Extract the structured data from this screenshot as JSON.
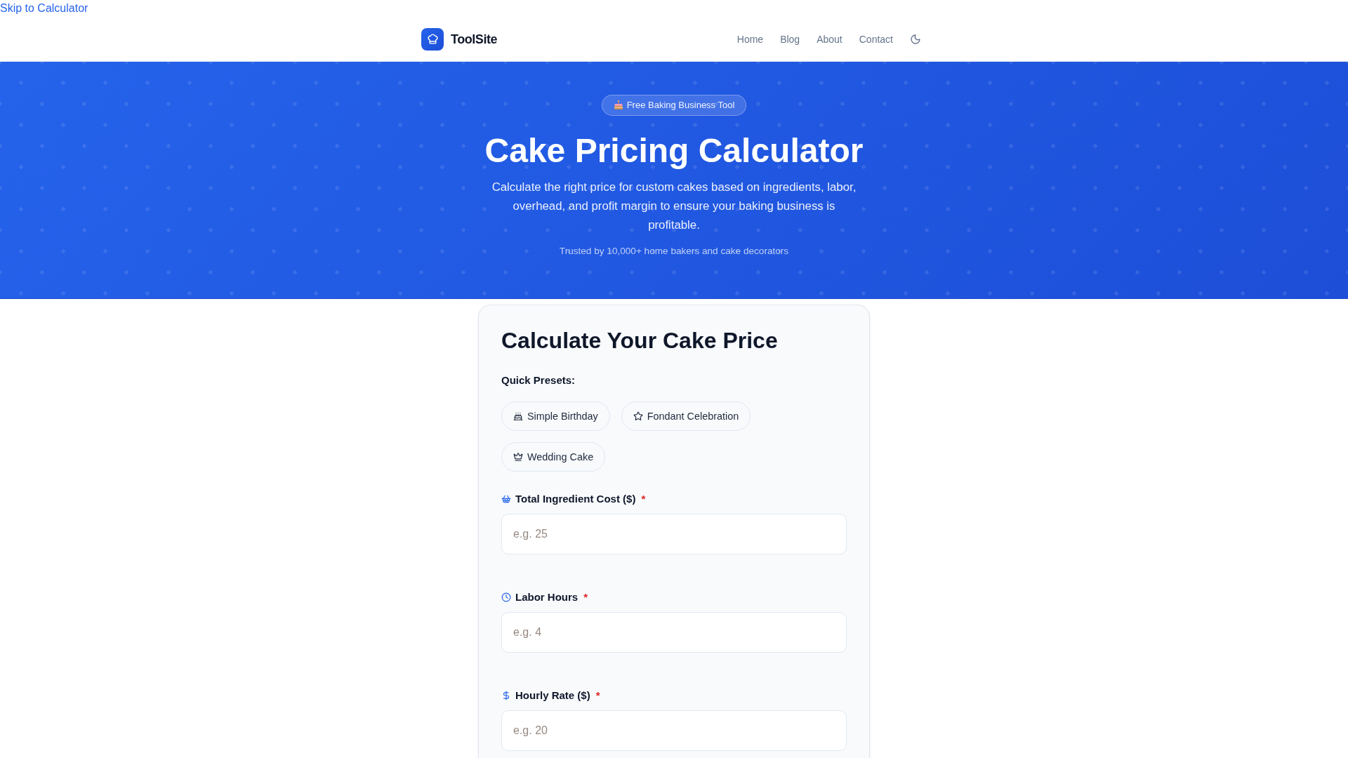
{
  "skip_link": {
    "label": "Skip to Calculator"
  },
  "header": {
    "logo": "ToolSite",
    "nav": [
      {
        "label": "Home"
      },
      {
        "label": "Blog"
      },
      {
        "label": "About"
      },
      {
        "label": "Contact"
      }
    ]
  },
  "hero": {
    "badge": "Free Baking Business Tool",
    "title": "Cake Pricing Calculator",
    "subtitle": "Calculate the right price for custom cakes based on ingredients, labor, overhead, and profit margin to ensure your baking business is profitable.",
    "trust_line": "Trusted by 10,000+ home bakers and cake decorators"
  },
  "calculator": {
    "title": "Calculate Your Cake Price",
    "presets_label": "Quick Presets:",
    "presets": [
      {
        "label": "Simple Birthday"
      },
      {
        "label": "Fondant Celebration"
      },
      {
        "label": "Wedding Cake"
      }
    ],
    "fields": [
      {
        "label": "Total Ingredient Cost ($)",
        "required_mark": "*",
        "placeholder": "e.g. 25"
      },
      {
        "label": "Labor Hours",
        "required_mark": "*",
        "placeholder": "e.g. 4"
      },
      {
        "label": "Hourly Rate ($)",
        "required_mark": "*",
        "placeholder": "e.g. 20"
      }
    ]
  }
}
